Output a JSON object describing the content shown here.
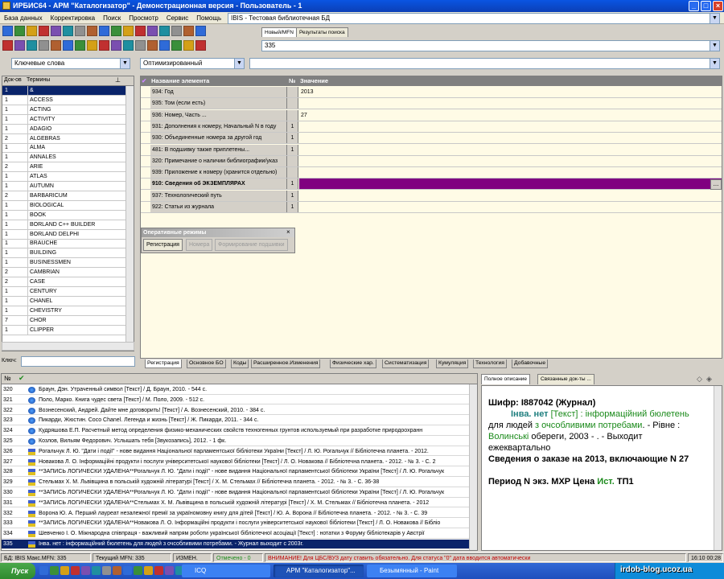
{
  "window": {
    "title": "ИРБИС64 - АРМ \"Каталогизатор\" - Демонстрационная версия - Пользователь - 1"
  },
  "menu": [
    "База данных",
    "Корректировка",
    "Поиск",
    "Просмотр",
    "Сервис",
    "Помощь"
  ],
  "database": {
    "selected": "IBIS - Тестовая библиотечная БД"
  },
  "top_tabs": [
    "Новый/MFN",
    "Результаты поиска"
  ],
  "mfn_value": "335",
  "dictionary_combo": "Ключевые слова",
  "mode_combo": "Оптимизированный",
  "terms": {
    "col_docs": "Док-ов",
    "col_terms": "Термины",
    "key_label": "Ключ:",
    "rows": [
      {
        "n": "1",
        "t": "&"
      },
      {
        "n": "1",
        "t": "ACCESS"
      },
      {
        "n": "1",
        "t": "ACTING"
      },
      {
        "n": "1",
        "t": "ACTIVITY"
      },
      {
        "n": "1",
        "t": "ADAGIO"
      },
      {
        "n": "2",
        "t": "ALGEBRAS"
      },
      {
        "n": "1",
        "t": "ALMA"
      },
      {
        "n": "1",
        "t": "ANNALES"
      },
      {
        "n": "2",
        "t": "ARIE"
      },
      {
        "n": "1",
        "t": "ATLAS"
      },
      {
        "n": "1",
        "t": "AUTUMN"
      },
      {
        "n": "2",
        "t": "BARBARICUM"
      },
      {
        "n": "1",
        "t": "BIOLOGICAL"
      },
      {
        "n": "1",
        "t": "BOOK"
      },
      {
        "n": "1",
        "t": "BORLAND C++ BUILDER"
      },
      {
        "n": "1",
        "t": "BORLAND DELPHI"
      },
      {
        "n": "1",
        "t": "BRAUCHE"
      },
      {
        "n": "1",
        "t": "BUILDING"
      },
      {
        "n": "1",
        "t": "BUSINESSMEN"
      },
      {
        "n": "2",
        "t": "CAMBRIAN"
      },
      {
        "n": "2",
        "t": "CASE"
      },
      {
        "n": "1",
        "t": "CENTURY"
      },
      {
        "n": "1",
        "t": "CHANEL"
      },
      {
        "n": "1",
        "t": "CHEVISTRY"
      },
      {
        "n": "7",
        "t": "CHOR"
      },
      {
        "n": "1",
        "t": "CLIPPER"
      }
    ]
  },
  "fields": {
    "col_name": "Название элемента",
    "col_no": "№",
    "col_value": "Значение",
    "rows": [
      {
        "name": "934: Год",
        "no": "",
        "value": "2013",
        "bold": false
      },
      {
        "name": "935: Том (если есть)",
        "no": "",
        "value": "",
        "bold": false
      },
      {
        "name": "936: Номер, Часть ...",
        "no": "",
        "value": "27",
        "bold": false
      },
      {
        "name": "931: Дополнения к номеру, Начальный N в году",
        "no": "1",
        "value": "",
        "bold": false
      },
      {
        "name": "930: Объединенные номера за другой год",
        "no": "1",
        "value": "",
        "bold": false
      },
      {
        "name": "481: В подшивку также приплетены...",
        "no": "1",
        "value": "",
        "bold": false
      },
      {
        "name": "320: Примечание о наличии библиографии/указ",
        "no": "",
        "value": "",
        "bold": false
      },
      {
        "name": "939: Приложение к номеру (хранится отдельно)",
        "no": "",
        "value": "",
        "bold": false
      },
      {
        "name": "910: Сведения  об ЭКЗЕМПЛЯРАХ",
        "no": "1",
        "value": "",
        "bold": true
      },
      {
        "name": "937: Технологический путь",
        "no": "1",
        "value": "",
        "bold": false
      },
      {
        "name": "922: Статьи из журнала",
        "no": "1",
        "value": "",
        "bold": false
      }
    ],
    "ellipsis": "..."
  },
  "oper_modes": {
    "title": "Оперативные режимы",
    "buttons": [
      "Регистрация",
      "Номера",
      "Формирование подшивки"
    ]
  },
  "bottom_tabs": [
    "Регистрация",
    "Основное БО",
    "Коды",
    "Расширенное.Изменения",
    "Физические хар.",
    "Систематизация",
    "Кумуляция",
    "Технология",
    "Добавочные"
  ],
  "records": {
    "col_no": "№",
    "rows": [
      {
        "n": "320",
        "t": "Браун, Дэн. Утраченный символ [Текст] / Д. Браун, 2010. - 544 с.",
        "type": "globe"
      },
      {
        "n": "321",
        "t": "Поло, Марко. Книга чудес света [Текст] / М. Поло, 2009. - 512 с.",
        "type": "globe"
      },
      {
        "n": "322",
        "t": "Вознесенский, Андрей. Дайте мне договорить! [Текст] / А. Вознесенский, 2010. - 384 с.",
        "type": "globe"
      },
      {
        "n": "323",
        "t": "Пикарди, Жюстин. Coco Chanel. Легенда и жизнь [Текст] / Ж. Пикарди, 2011. - 344 с.",
        "type": "globe"
      },
      {
        "n": "324",
        "t": "Кудряшова Е.П. Расчетный метод определения физико-механических свойств техногенных грунтов используемый при разработке природоохранн",
        "type": "globe"
      },
      {
        "n": "325",
        "t": "Козлов, Вильям Федорович. Услышать тебя [Звукозапись], 2012. - 1 фк.",
        "type": "globe"
      },
      {
        "n": "326",
        "t": "Рогальчук Л. Ю. \"Дати і події\" - нове видання Національної парламентської бібліотеки України [Текст] / Л. Ю. Рогальчук // Бібліотечна планета. - 2012.",
        "type": "flag"
      },
      {
        "n": "327",
        "t": "Новакова Л. О. Інформаційні продукти і послуги університетської наукової бібліотеки [Текст] / Л. О. Новакова // Бібліотечна планета. - 2012. - № 3. - С. 2",
        "type": "flag"
      },
      {
        "n": "328",
        "t": "**ЗАПИСЬ ЛОГИЧЕСКИ УДАЛЕНА**Рогальчук Л. Ю. \"Дати і події\" - нове видання Національної парламентської бібліотеки України [Текст] / Л. Ю. Рогальчук",
        "type": "flag"
      },
      {
        "n": "329",
        "t": "Стельмах Х. М. Львівщина в польській художній літературі [Текст] / Х. М. Стельмах // Бібліотечна планета. - 2012. - № 3. - С. 36-38",
        "type": "flag"
      },
      {
        "n": "330",
        "t": "**ЗАПИСЬ ЛОГИЧЕСКИ УДАЛЕНА**Рогальчук Л. Ю. \"Дати і події\" - нове видання Національної парламентської бібліотеки України [Текст] / Л. Ю. Рогальчук",
        "type": "flag"
      },
      {
        "n": "331",
        "t": "**ЗАПИСЬ ЛОГИЧЕСКИ УДАЛЕНА**Стельмах Х. М. Львівщина в польській художній літературі [Текст] / Х. М. Стельмах // Бібліотечна планета. - 2012",
        "type": "flag"
      },
      {
        "n": "332",
        "t": "Ворона Ю. А. Перший лауреат незалежної премії за україномовну книгу для дітей [Текст] / Ю. А. Ворона // Бібліотечна планета. - 2012. - № 3. - С. 39",
        "type": "flag"
      },
      {
        "n": "333",
        "t": "**ЗАПИСЬ ЛОГИЧЕСКИ УДАЛЕНА**Новакова Л. О. Інформаційні продукти і послуги університетської наукової бібліотеки [Текст] / Л. О. Новакова // Бібліо",
        "type": "flag"
      },
      {
        "n": "334",
        "t": "Шевченко І. О. Міжнародна співпраця - важливий напрям роботи української бібліотечної асоціації [Текст] : нотатки з Форуму бібліотекарів у Австрії",
        "type": "flag"
      },
      {
        "n": "335",
        "t": "Інва. нет : інформаційний бюлетень для людей з очсобливими потребами. - Журнал выходит с 2003г.",
        "type": "flag"
      }
    ]
  },
  "right_tabs": [
    "Полное описание",
    "Связанные док-ты ..."
  ],
  "description": {
    "shifr": "Шифр: I887042 (Журнал)",
    "title_bold": "Інва. нет",
    "title_rest": " [Текст] : інформаційний бюлетень",
    "line2a": "для людей ",
    "line2b": "з очсобливими потребами",
    "line2c": ". - Рівне :",
    "line3a": "Волинські",
    "line3b": " обереги, 2003 - . - Выходит",
    "line4": "ежеквартально",
    "order": "Сведения о заказе на 2013, включающие N 27",
    "period_a": "Период N экз. МХР Цена ",
    "period_b": "Ист.",
    "period_c": " ТП1"
  },
  "status": {
    "db": "БД: IBIS Макс.MFN: 335",
    "current": "Текущий MFN: 335",
    "changed": "ИЗМЕН.",
    "marked": "Отмечено - 0",
    "warning": "ВНИМАНИЕ! Для ЦБС/ВУЗ дату ставить обязательно. Для статуса \"0\" дата вводится автоматически",
    "time": "16:10  00:28"
  },
  "taskbar": {
    "start": "Пуск",
    "tasks": [
      "ICQ",
      "АРМ \"Каталогизатор\"...",
      "Безымянный - Paint"
    ],
    "watermark": "irdob-blog.ucoz.ua"
  },
  "colors": {
    "selected_row": "#800080",
    "title_blue": "#0a55e2",
    "green_text": "#1a8a1a",
    "teal_text": "#1f7f7f"
  }
}
